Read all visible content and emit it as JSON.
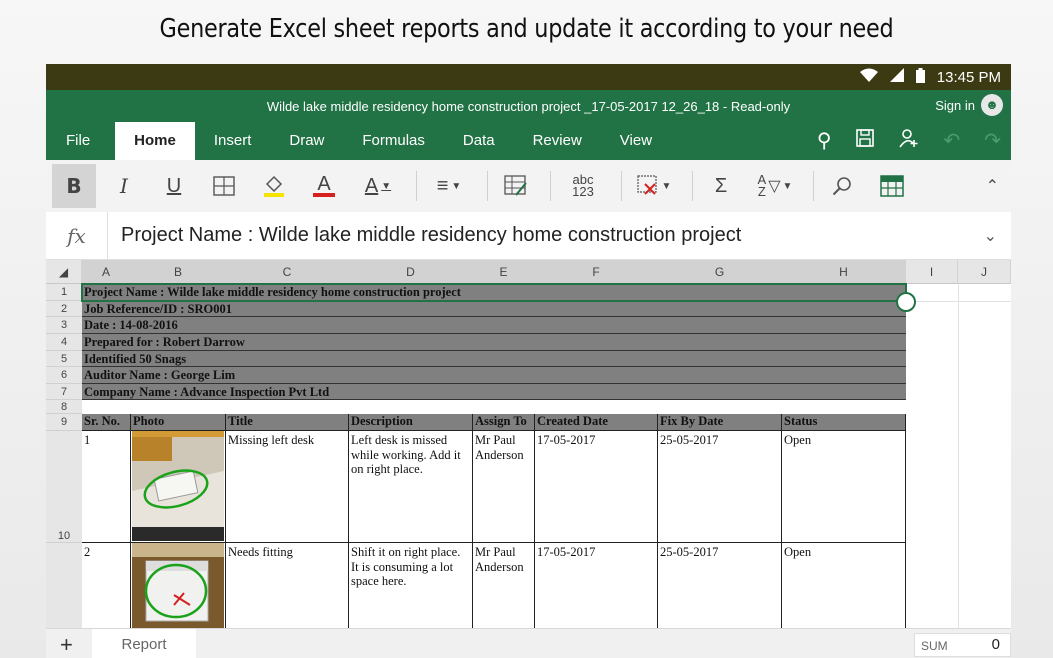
{
  "banner": "Generate Excel sheet reports and update it according to your need",
  "status_bar": {
    "time": "13:45 PM",
    "icons": [
      "wifi-icon",
      "signal-icon",
      "battery-icon"
    ]
  },
  "titlebar": {
    "title": "Wilde lake middle residency home construction project _17-05-2017 12_26_18 - Read-only",
    "sign_in": "Sign in"
  },
  "tabs": [
    "File",
    "Home",
    "Insert",
    "Draw",
    "Formulas",
    "Data",
    "Review",
    "View"
  ],
  "active_tab": "Home",
  "ribbon": {
    "bold": "B",
    "italic": "I",
    "underline": "U",
    "font_color": "A",
    "text_style": "A",
    "number_format": "abc\n123",
    "sum": "Σ"
  },
  "formula_bar": {
    "fx": "fx",
    "value": "Project Name : Wilde lake middle residency home construction project"
  },
  "columns": [
    "A",
    "B",
    "C",
    "D",
    "E",
    "F",
    "G",
    "H",
    "I",
    "J"
  ],
  "info_rows": [
    {
      "row": "1",
      "text": "Project Name : Wilde lake middle residency home construction project"
    },
    {
      "row": "2",
      "text": "Job Reference/ID : SRO001"
    },
    {
      "row": "3",
      "text": "Date : 14-08-2016"
    },
    {
      "row": "4",
      "text": "Prepared for : Robert Darrow"
    },
    {
      "row": "5",
      "text": "Identified 50 Snags"
    },
    {
      "row": "6",
      "text": "Auditor Name : George Lim"
    },
    {
      "row": "7",
      "text": "Company Name : Advance Inspection Pvt Ltd"
    }
  ],
  "empty_row": "8",
  "table": {
    "row": "9",
    "headers": [
      "Sr. No.",
      "Photo",
      "Title",
      "Description",
      "Assign To",
      "Created Date",
      "Fix By Date",
      "Status"
    ],
    "rows": [
      {
        "row": "10",
        "sr": "1",
        "title": "Missing left desk",
        "description": "Left desk is missed while working. Add it on right place.",
        "assign": "Mr Paul Anderson",
        "created": "17-05-2017",
        "fix_by": "25-05-2017",
        "status": "Open"
      },
      {
        "row": "",
        "sr": "2",
        "title": "Needs fitting",
        "description": "Shift it on right place. It is consuming a lot space here.",
        "assign": "Mr Paul Anderson",
        "created": "17-05-2017",
        "fix_by": "25-05-2017",
        "status": "Open"
      }
    ]
  },
  "sheet_bar": {
    "add": "+",
    "sheet_name": "Report",
    "sum_label": "SUM",
    "sum_value": "0"
  },
  "colors": {
    "excel_green": "#217346",
    "header_gray": "#808080",
    "status_bar": "#3c3a12"
  }
}
